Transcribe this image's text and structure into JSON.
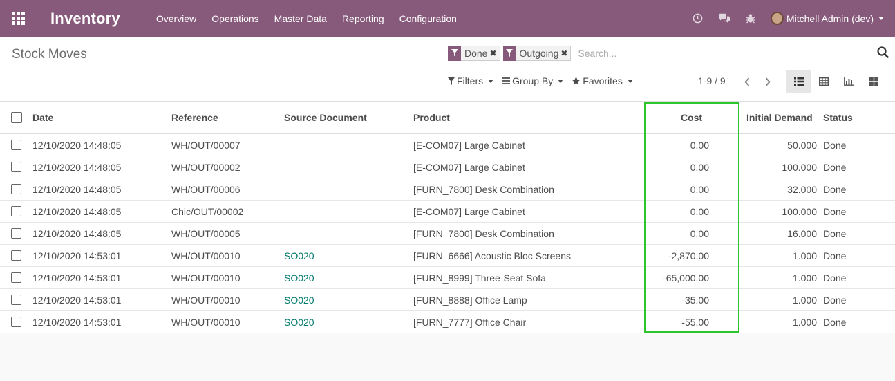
{
  "navbar": {
    "brand": "Inventory",
    "menu": [
      "Overview",
      "Operations",
      "Master Data",
      "Reporting",
      "Configuration"
    ],
    "user": "Mitchell Admin (dev)"
  },
  "control_panel": {
    "title": "Stock Moves",
    "facets": [
      {
        "label": "Done"
      },
      {
        "label": "Outgoing"
      }
    ],
    "search_placeholder": "Search...",
    "filters_label": "Filters",
    "groupby_label": "Group By",
    "favorites_label": "Favorites",
    "pager": "1-9 / 9"
  },
  "table": {
    "headers": {
      "date": "Date",
      "reference": "Reference",
      "source": "Source Document",
      "product": "Product",
      "cost": "Cost",
      "demand": "Initial Demand",
      "status": "Status"
    },
    "rows": [
      {
        "date": "12/10/2020 14:48:05",
        "reference": "WH/OUT/00007",
        "source": "",
        "product": "[E-COM07] Large Cabinet",
        "cost": "0.00",
        "demand": "50.000",
        "status": "Done"
      },
      {
        "date": "12/10/2020 14:48:05",
        "reference": "WH/OUT/00002",
        "source": "",
        "product": "[E-COM07] Large Cabinet",
        "cost": "0.00",
        "demand": "100.000",
        "status": "Done"
      },
      {
        "date": "12/10/2020 14:48:05",
        "reference": "WH/OUT/00006",
        "source": "",
        "product": "[FURN_7800] Desk Combination",
        "cost": "0.00",
        "demand": "32.000",
        "status": "Done"
      },
      {
        "date": "12/10/2020 14:48:05",
        "reference": "Chic/OUT/00002",
        "source": "",
        "product": "[E-COM07] Large Cabinet",
        "cost": "0.00",
        "demand": "100.000",
        "status": "Done"
      },
      {
        "date": "12/10/2020 14:48:05",
        "reference": "WH/OUT/00005",
        "source": "",
        "product": "[FURN_7800] Desk Combination",
        "cost": "0.00",
        "demand": "16.000",
        "status": "Done"
      },
      {
        "date": "12/10/2020 14:53:01",
        "reference": "WH/OUT/00010",
        "source": "SO020",
        "product": "[FURN_6666] Acoustic Bloc Screens",
        "cost": "-2,870.00",
        "demand": "1.000",
        "status": "Done"
      },
      {
        "date": "12/10/2020 14:53:01",
        "reference": "WH/OUT/00010",
        "source": "SO020",
        "product": "[FURN_8999] Three-Seat Sofa",
        "cost": "-65,000.00",
        "demand": "1.000",
        "status": "Done"
      },
      {
        "date": "12/10/2020 14:53:01",
        "reference": "WH/OUT/00010",
        "source": "SO020",
        "product": "[FURN_8888] Office Lamp",
        "cost": "-35.00",
        "demand": "1.000",
        "status": "Done"
      },
      {
        "date": "12/10/2020 14:53:01",
        "reference": "WH/OUT/00010",
        "source": "SO020",
        "product": "[FURN_7777] Office Chair",
        "cost": "-55.00",
        "demand": "1.000",
        "status": "Done"
      }
    ]
  },
  "colors": {
    "navbar": "#875a7b",
    "link": "#00796b",
    "highlight": "#2cc52c"
  }
}
